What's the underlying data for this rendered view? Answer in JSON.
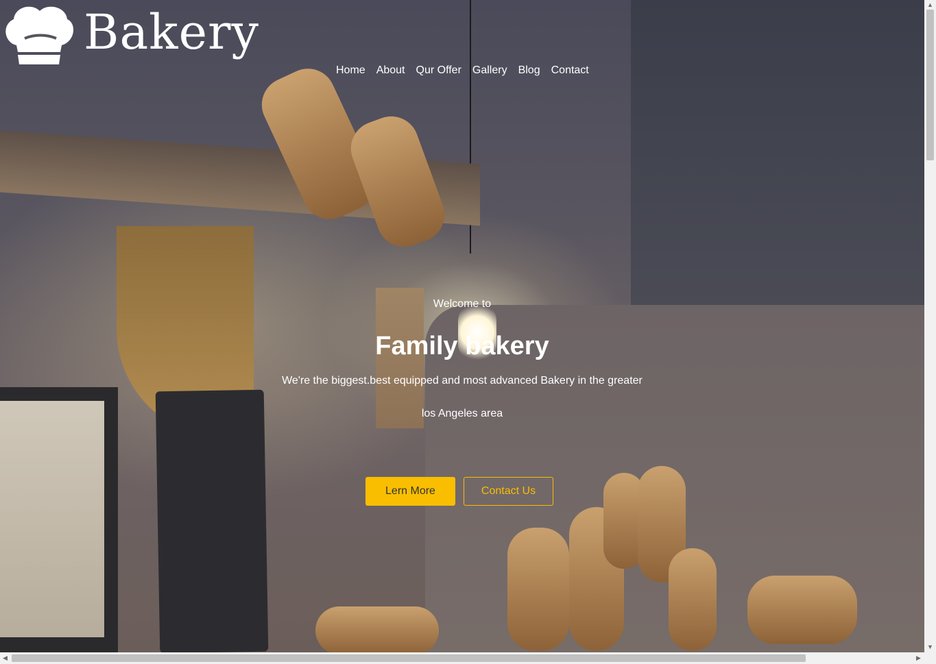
{
  "brand": {
    "name": "Bakery",
    "icon": "chef-hat-icon"
  },
  "nav": {
    "items": [
      {
        "label": "Home"
      },
      {
        "label": "About"
      },
      {
        "label": "Qur Offer"
      },
      {
        "label": "Gallery"
      },
      {
        "label": "Blog"
      },
      {
        "label": "Contact"
      }
    ]
  },
  "hero": {
    "welcome": "Welcome to",
    "title": "Family bakery",
    "description_line1": "We're the biggest.best equipped and most advanced Bakery in the greater",
    "description_line2": "los Angeles area",
    "primary_button": "Lern More",
    "secondary_button": "Contact Us",
    "background": "bakery-interior-photo"
  },
  "colors": {
    "accent": "#f9be00",
    "text": "#ffffff"
  }
}
